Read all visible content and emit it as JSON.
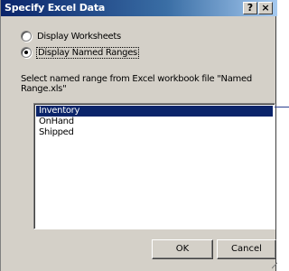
{
  "window": {
    "title": "Specify Excel Data",
    "help_label": "?",
    "close_label": "×"
  },
  "radios": [
    {
      "label": "Display Worksheets",
      "checked": false
    },
    {
      "label": "Display Named Ranges",
      "checked": true
    }
  ],
  "instructions": "Select named range from Excel workbook file \"Named Range.xls\"",
  "list": {
    "items": [
      "Inventory",
      "OnHand",
      "Shipped"
    ],
    "selected_index": 0
  },
  "buttons": {
    "ok_label": "OK",
    "cancel_label": "Cancel"
  },
  "colors": {
    "title_bar": "#0a246a",
    "selection": "#0a246a",
    "dialog_face": "#d4d0c8"
  }
}
